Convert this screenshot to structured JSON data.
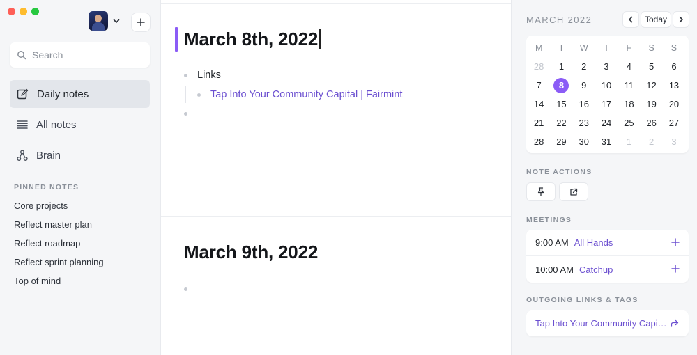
{
  "sidebar": {
    "search_placeholder": "Search",
    "nav": [
      {
        "label": "Daily notes",
        "active": true,
        "icon": "edit-icon"
      },
      {
        "label": "All notes",
        "active": false,
        "icon": "list-icon"
      },
      {
        "label": "Brain",
        "active": false,
        "icon": "graph-icon"
      }
    ],
    "pinned_title": "PINNED NOTES",
    "pinned": [
      "Core projects",
      "Reflect master plan",
      "Reflect roadmap",
      "Reflect sprint planning",
      "Top of mind"
    ]
  },
  "main": {
    "days": [
      {
        "title": "March 8th, 2022",
        "bullets": [
          {
            "text": "Links",
            "children": [
              {
                "text": "Tap Into Your Community Capital | Fairmint",
                "link": true
              }
            ]
          },
          {
            "text": ""
          }
        ]
      },
      {
        "title": "March 9th, 2022",
        "bullets": [
          {
            "text": ""
          }
        ]
      }
    ]
  },
  "calendar": {
    "month_label": "MARCH 2022",
    "today_label": "Today",
    "weekdays": [
      "M",
      "T",
      "W",
      "T",
      "F",
      "S",
      "S"
    ],
    "weeks": [
      [
        "28",
        "1",
        "2",
        "3",
        "4",
        "5",
        "6"
      ],
      [
        "7",
        "8",
        "9",
        "10",
        "11",
        "12",
        "13"
      ],
      [
        "14",
        "15",
        "16",
        "17",
        "18",
        "19",
        "20"
      ],
      [
        "21",
        "22",
        "23",
        "24",
        "25",
        "26",
        "27"
      ],
      [
        "28",
        "29",
        "30",
        "31",
        "1",
        "2",
        "3"
      ]
    ],
    "selected": "8",
    "accent": "#8b5cf6"
  },
  "note_actions": {
    "title": "NOTE ACTIONS",
    "buttons": [
      "pin-icon",
      "external-link-icon"
    ]
  },
  "meetings": {
    "title": "MEETINGS",
    "items": [
      {
        "time": "9:00 AM",
        "name": "All Hands"
      },
      {
        "time": "10:00 AM",
        "name": "Catchup"
      }
    ]
  },
  "outgoing": {
    "title": "OUTGOING LINKS & TAGS",
    "items": [
      "Tap Into Your Community Capital | Fairmint"
    ]
  },
  "colors": {
    "accent": "#8b5cf6",
    "link": "#6b4fd0"
  }
}
